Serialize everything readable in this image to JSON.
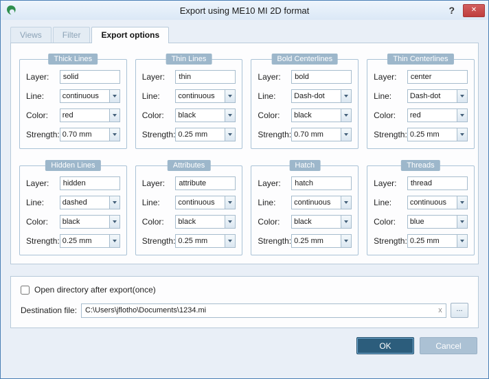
{
  "window": {
    "title": "Export using ME10 MI 2D format",
    "help_label": "?",
    "close_label": "✕"
  },
  "tabs": [
    {
      "label": "Views"
    },
    {
      "label": "Filter"
    },
    {
      "label": "Export options"
    }
  ],
  "field_labels": {
    "layer": "Layer:",
    "line": "Line:",
    "color": "Color:",
    "strength": "Strength:"
  },
  "groups": [
    {
      "title": "Thick Lines",
      "layer": "solid",
      "line": "continuous",
      "color": "red",
      "strength": "0.70 mm"
    },
    {
      "title": "Thin Lines",
      "layer": "thin",
      "line": "continuous",
      "color": "black",
      "strength": "0.25 mm"
    },
    {
      "title": "Bold Centerlines",
      "layer": "bold",
      "line": "Dash-dot",
      "color": "black",
      "strength": "0.70 mm"
    },
    {
      "title": "Thin Centerlines",
      "layer": "center",
      "line": "Dash-dot",
      "color": "red",
      "strength": "0.25 mm"
    },
    {
      "title": "Hidden Lines",
      "layer": "hidden",
      "line": "dashed",
      "color": "black",
      "strength": "0.25 mm"
    },
    {
      "title": "Attributes",
      "layer": "attribute",
      "line": "continuous",
      "color": "black",
      "strength": "0.25 mm"
    },
    {
      "title": "Hatch",
      "layer": "hatch",
      "line": "continuous",
      "color": "black",
      "strength": "0.25 mm"
    },
    {
      "title": "Threads",
      "layer": "thread",
      "line": "continuous",
      "color": "blue",
      "strength": "0.25 mm"
    }
  ],
  "bottom": {
    "checkbox_label": "Open directory after export(once)",
    "checkbox_checked": false,
    "destination_label": "Destination file:",
    "destination_value": "C:\\Users\\jflotho\\Documents\\1234.mi",
    "clear_label": "x",
    "browse_label": "..."
  },
  "buttons": {
    "ok": "OK",
    "cancel": "Cancel"
  },
  "colors": {
    "close_button": "#c74b4b",
    "ok_button": "#2c5d7c",
    "cancel_button": "#abc1d4",
    "group_title_bg": "#9db7cb",
    "window_border": "#4a7fb5"
  }
}
